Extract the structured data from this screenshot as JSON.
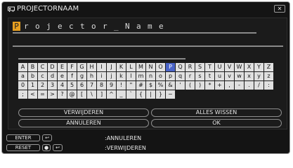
{
  "window": {
    "title": "PROJECTORNAAM",
    "close_symbol": "✕",
    "title_icon": "projector-icon"
  },
  "name_field": {
    "chars": [
      "P",
      "r",
      "o",
      "j",
      "e",
      "c",
      "t",
      "o",
      "r",
      "_",
      "N",
      "a",
      "m",
      "e"
    ],
    "cursor_index": 0
  },
  "keyboard": {
    "rows": [
      [
        "A",
        "B",
        "C",
        "D",
        "E",
        "F",
        "G",
        "H",
        "I",
        "J",
        "K",
        "L",
        "M",
        "N",
        "O",
        "P",
        "Q",
        "R",
        "S",
        "T",
        "U",
        "V",
        "W",
        "X",
        "Y",
        "Z"
      ],
      [
        "a",
        "b",
        "c",
        "d",
        "e",
        "f",
        "g",
        "h",
        "i",
        "j",
        "k",
        "l",
        "m",
        "n",
        "o",
        "p",
        "q",
        "r",
        "s",
        "t",
        "u",
        "v",
        "w",
        "x",
        "y",
        "z"
      ],
      [
        "0",
        "1",
        "2",
        "3",
        "4",
        "5",
        "6",
        "7",
        "8",
        "9",
        "!",
        "\"",
        "#",
        "$",
        "%",
        "&",
        "'",
        "(",
        ")",
        "*",
        "+",
        ",",
        "-",
        ".",
        "/",
        ":"
      ],
      [
        ";",
        "<",
        "=",
        ">",
        "?",
        "@",
        "[",
        "\\",
        "]",
        "^",
        "_",
        "`",
        "{",
        "|",
        "}",
        "~"
      ]
    ],
    "selected": "P"
  },
  "buttons": {
    "delete": "VERWIJDEREN",
    "clear_all": "ALLES WISSEN",
    "cancel": "ANNULEREN",
    "ok": "OK"
  },
  "help": [
    {
      "key": "ENTER",
      "action": ":ANNULEREN"
    },
    {
      "key": "RESET",
      "action": ":VERWIJDEREN"
    }
  ]
}
